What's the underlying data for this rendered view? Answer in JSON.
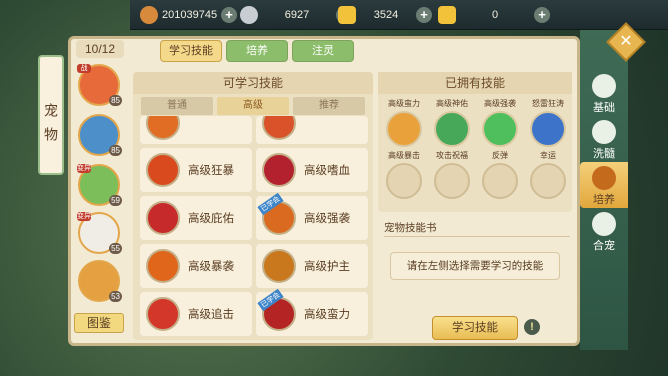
{
  "resources": [
    {
      "name": "copper-coin-icon",
      "value": "201039745",
      "color": "#d88a3c"
    },
    {
      "name": "silver-coin-icon",
      "value": "6927",
      "color": "#c8cdd2"
    },
    {
      "name": "gold-ingot-icon",
      "value": "3524",
      "color": "#f2c23b"
    },
    {
      "name": "gold-treasure-icon",
      "value": "0",
      "color": "#f2c23b"
    }
  ],
  "side_title": "宠物",
  "pet_count": "10/12",
  "pets": [
    {
      "level": "85",
      "tag": "战",
      "color": "#e76a3a"
    },
    {
      "level": "85",
      "tag": "",
      "color": "#4c8fc9"
    },
    {
      "level": "59",
      "tag": "变异",
      "color": "#7cbf5a"
    },
    {
      "level": "55",
      "tag": "变异",
      "color": "#f0ede6"
    },
    {
      "level": "53",
      "tag": "",
      "color": "#e5a042"
    }
  ],
  "pet_book_label": "图鉴",
  "tabs": [
    "学习技能",
    "培养",
    "注灵"
  ],
  "learn_box": {
    "title": "可学习技能",
    "categories": [
      "普通",
      "高级",
      "推荐"
    ],
    "skills": [
      {
        "name": "高级狂暴",
        "learned": false,
        "color": "#d94a1f"
      },
      {
        "name": "高级嗜血",
        "learned": false,
        "color": "#b3202e"
      },
      {
        "name": "高级庇佑",
        "learned": false,
        "color": "#c62a2a"
      },
      {
        "name": "高级强袭",
        "learned": true,
        "color": "#d96a1f"
      },
      {
        "name": "高级暴袭",
        "learned": false,
        "color": "#e0661b"
      },
      {
        "name": "高级护主",
        "learned": false,
        "color": "#c9781e"
      },
      {
        "name": "高级追击",
        "learned": false,
        "color": "#d2372a"
      },
      {
        "name": "高级蛮力",
        "learned": true,
        "color": "#b42424"
      }
    ],
    "learned_label": "已学会"
  },
  "own_box": {
    "title": "已拥有技能",
    "skills": [
      {
        "name": "高级蛮力",
        "color": "#e9a23b"
      },
      {
        "name": "高级神佑",
        "color": "#48a85a"
      },
      {
        "name": "高级强袭",
        "color": "#4fbf5e"
      },
      {
        "name": "怒雷狂涛",
        "color": "#3d74c9"
      },
      {
        "name": "高级暴击",
        "color": "#e07a2b"
      },
      {
        "name": "攻击祝福",
        "color": "#5bb56b"
      },
      {
        "name": "反弹",
        "color": "#6cc74c"
      },
      {
        "name": "幸运",
        "color": "#4f8fd6"
      }
    ]
  },
  "book_title": "宠物技能书",
  "hint_text": "请在左侧选择需要学习的技能",
  "learn_button": "学习技能",
  "nav": [
    "基础",
    "洗髓",
    "培养",
    "合宠"
  ]
}
